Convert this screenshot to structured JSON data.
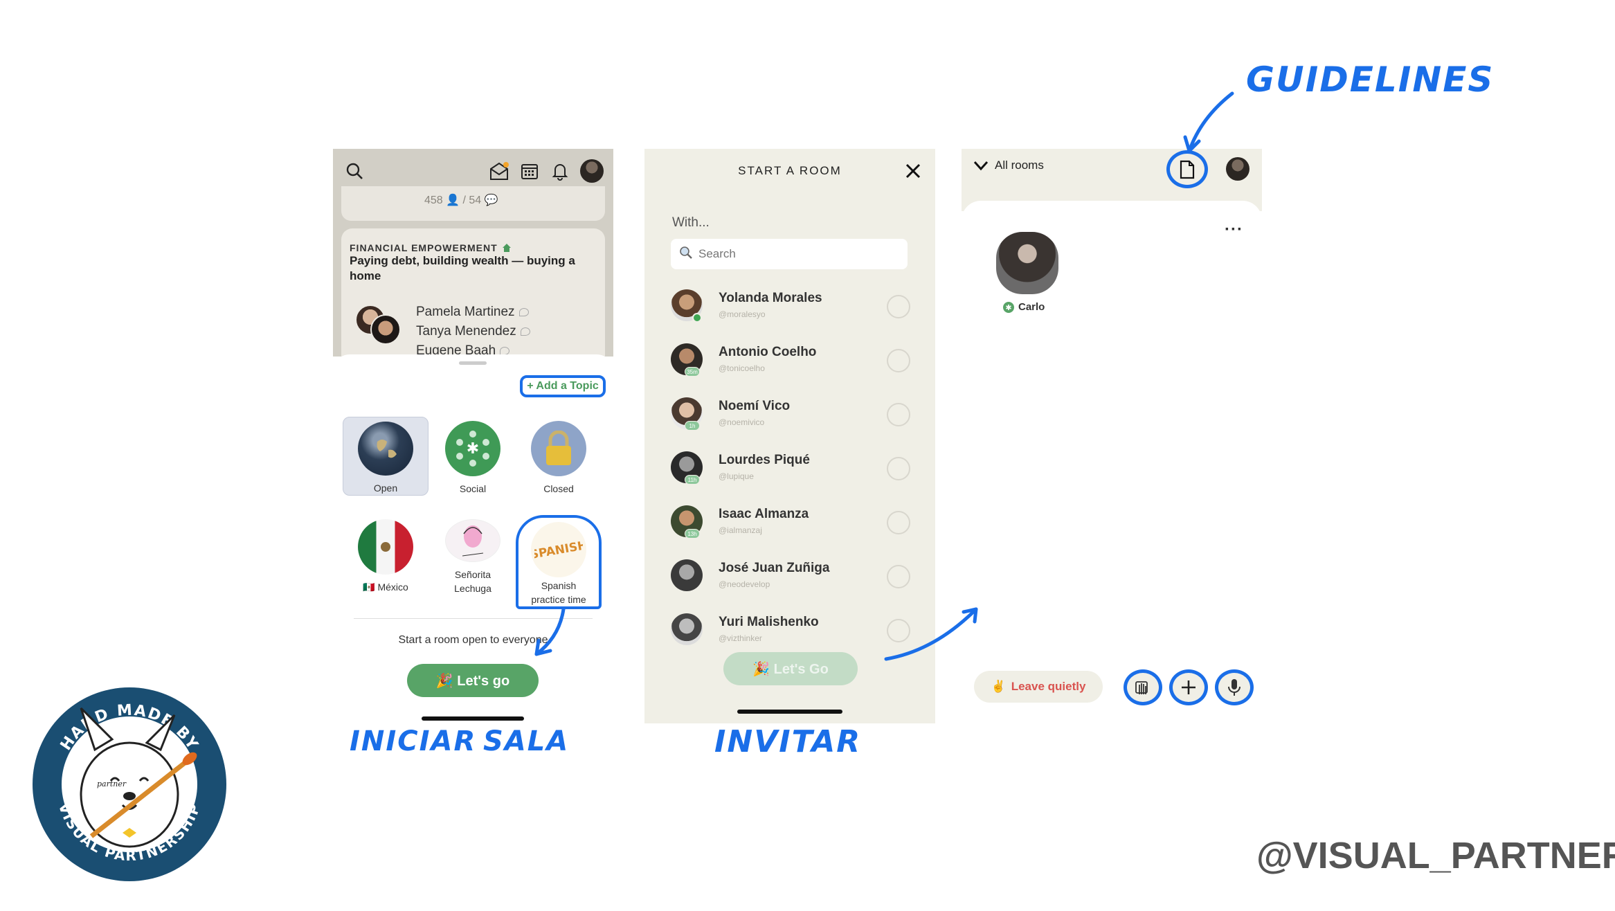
{
  "screen1": {
    "prev_counts": "458 👤 / 54 💬",
    "club_name": "FINANCIAL EMPOWERMENT",
    "room_title": "Paying debt, building wealth — buying a home",
    "speakers": [
      "Pamela Martinez",
      "Tanya Menendez",
      "Eugene Baah"
    ],
    "add_topic": "+ Add a Topic",
    "room_types": [
      {
        "label": "Open",
        "icon": "globe-icon"
      },
      {
        "label": "Social",
        "icon": "social-people-icon"
      },
      {
        "label": "Closed",
        "icon": "lock-icon"
      }
    ],
    "clubs": [
      {
        "label": "🇲🇽 México",
        "icon": "mexico-flag-icon"
      },
      {
        "label": "Señorita\nLechuga",
        "icon": "senorita-lechuga-icon"
      },
      {
        "label": "Spanish\npractice time",
        "icon": "spanish-club-icon"
      }
    ],
    "start_text": "Start a room open to everyone",
    "go_label": "🎉 Let's go"
  },
  "screen2": {
    "title": "START A ROOM",
    "with_label": "With...",
    "search_placeholder": "Search",
    "contacts": [
      {
        "name": "Yolanda Morales",
        "handle": "@moralesyo",
        "badge": ""
      },
      {
        "name": "Antonio Coelho",
        "handle": "@tonicoelho",
        "badge": "35m"
      },
      {
        "name": "Noemí Vico",
        "handle": "@noemivico",
        "badge": "1h"
      },
      {
        "name": "Lourdes Piqué",
        "handle": "@lupique",
        "badge": "11h"
      },
      {
        "name": "Isaac Almanza",
        "handle": "@ialmanzaj",
        "badge": "13h"
      },
      {
        "name": "José Juan Zuñiga",
        "handle": "@neodevelop",
        "badge": ""
      },
      {
        "name": "Yuri Malishenko",
        "handle": "@vizthinker",
        "badge": ""
      }
    ],
    "go_label": "🎉 Let's Go"
  },
  "screen3": {
    "all_rooms": "All rooms",
    "more": "···",
    "speaker_name": "Carlo",
    "leave_label": "Leave quietly"
  },
  "annotations": {
    "iniciar": "INICIAR",
    "sala": "SALA",
    "invitar": "INVITAR",
    "guidelines": "GUIDELINES"
  },
  "footer_handle": "@VISUAL_PARTNER",
  "badge_text": {
    "top": "HAND MADE BY",
    "bottom": "VISUAL PARTNERSHIP",
    "center": "partner"
  },
  "colors": {
    "accent_blue": "#1a6ee8",
    "brand_green": "#58a467",
    "leave_red": "#d9534f",
    "beige_bg": "#f0efe6"
  }
}
